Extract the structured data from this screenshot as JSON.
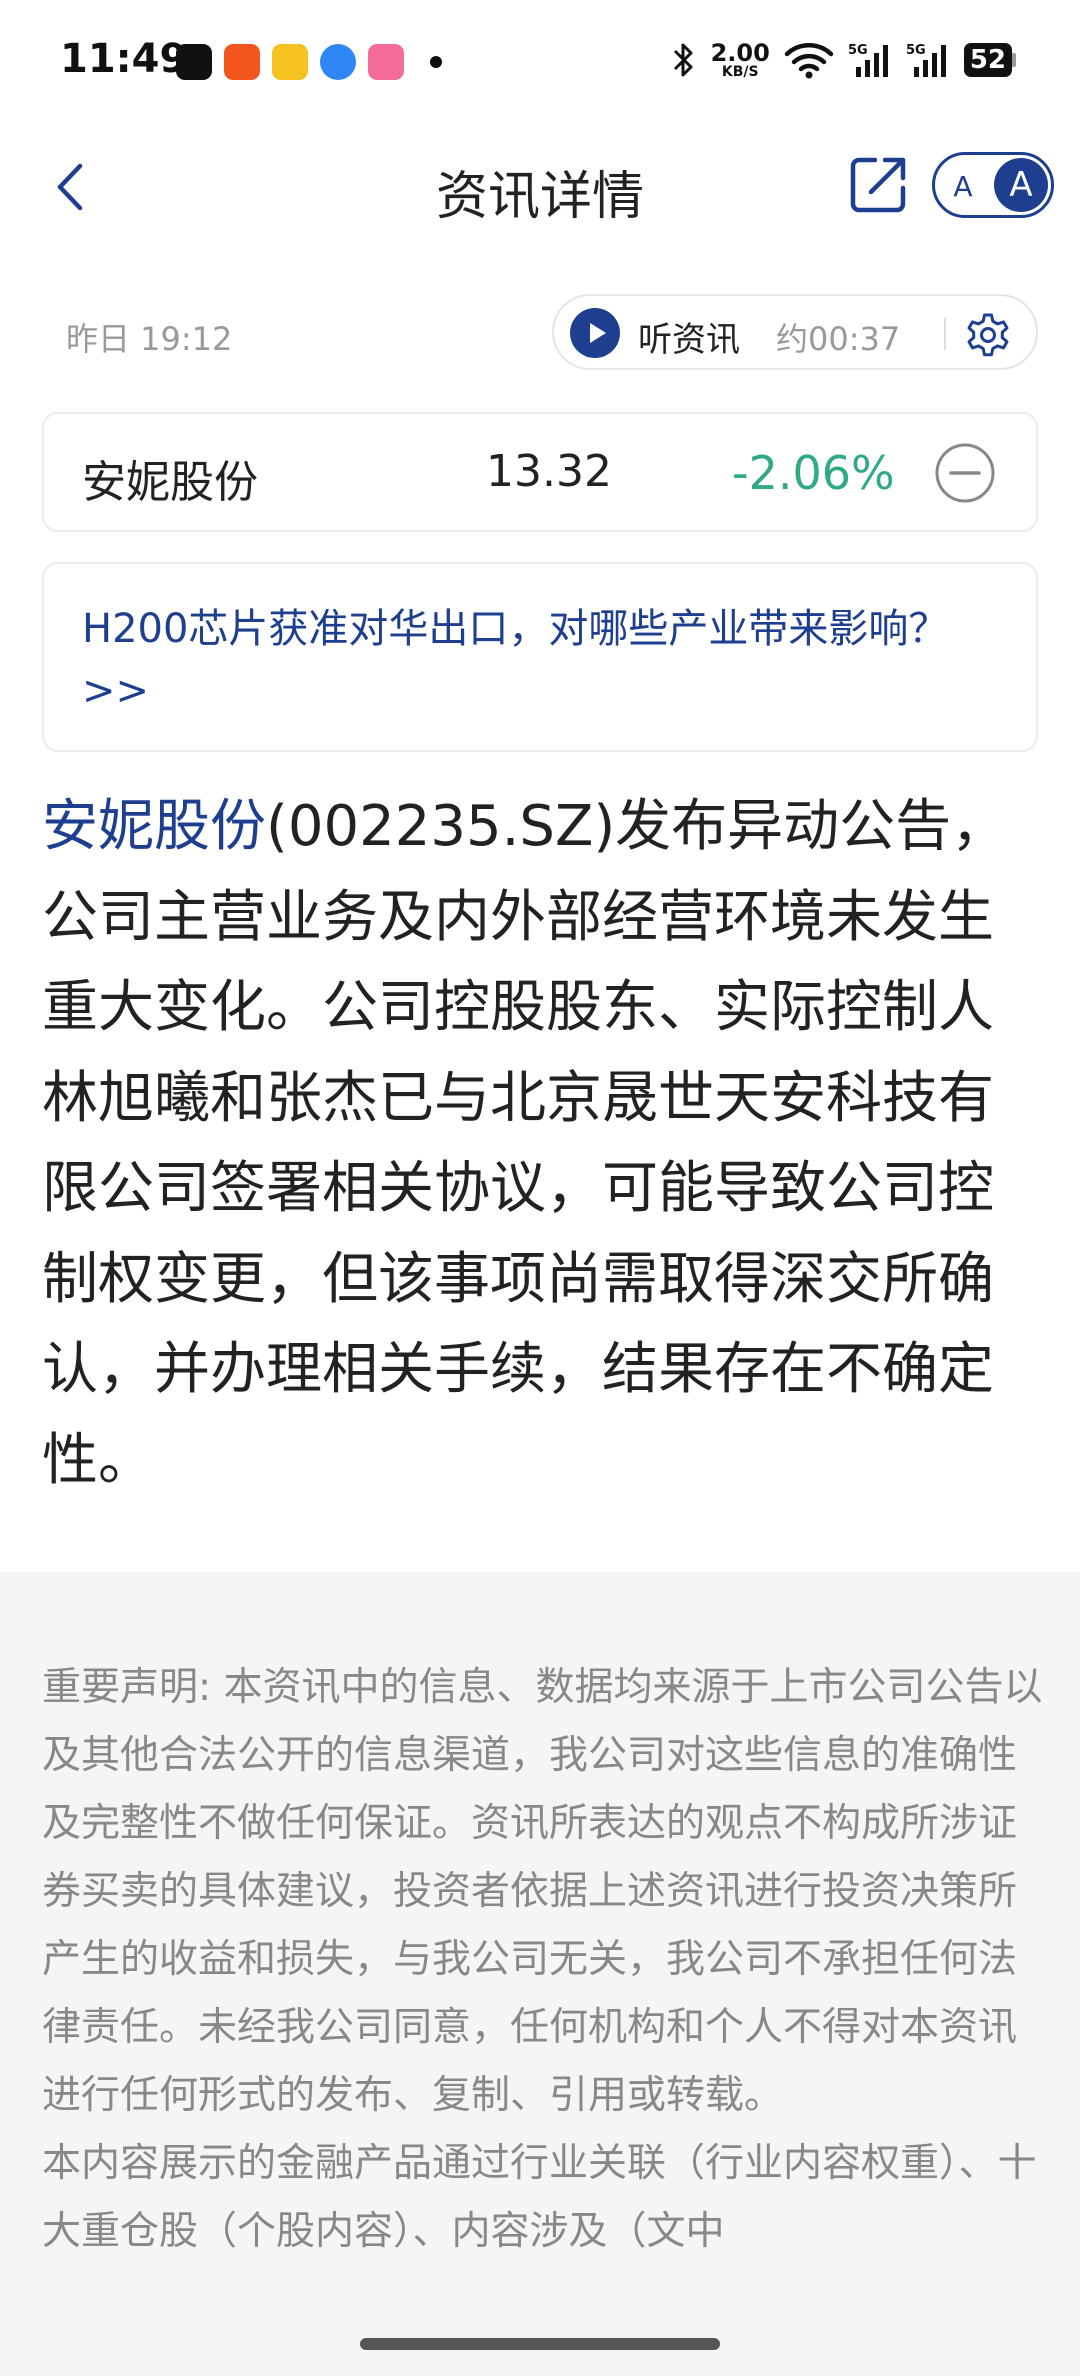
{
  "status_bar": {
    "time": "11:49",
    "net_speed_value": "2.00",
    "net_speed_unit": "KB/S",
    "battery": "52",
    "app_icons": [
      "tiktok-icon",
      "taobao-icon",
      "weibo-icon",
      "ali-icon",
      "bilibili-icon"
    ]
  },
  "nav": {
    "title": "资讯详情",
    "font_toggle_small": "A",
    "font_toggle_large": "A"
  },
  "meta": {
    "time": "昨日 19:12",
    "listen_label": "听资讯",
    "listen_duration": "约00:37"
  },
  "stock": {
    "name": "安妮股份",
    "price": "13.32",
    "change": "-2.06%"
  },
  "topic": {
    "text": "H200芯片获准对华出口，对哪些产业带来影响？>>"
  },
  "article": {
    "stock_link": "安妮股份",
    "body": "(002235.SZ)发布异动公告，公司主营业务及内外部经营环境未发生重大变化。公司控股股东、实际控制人林旭曦和张杰已与北京晟世天安科技有限公司签署相关协议，可能导致公司控制权变更，但该事项尚需取得深交所确认，并办理相关手续，结果存在不确定性。"
  },
  "disclaimer": {
    "statement": "重要声明: 本资讯中的信息、数据均来源于上市公司公告以及其他合法公开的信息渠道，我公司对这些信息的准确性及完整性不做任何保证。资讯所表达的观点不构成所涉证券买卖的具体建议，投资者依据上述资讯进行投资决策所产生的收益和损失，与我公司无关，我公司不承担任何法律责任。未经我公司同意，任何机构和个人不得对本资讯进行任何形式的发布、复制、引用或转载。",
    "product_note": "本内容展示的金融产品通过行业关联（行业内容权重）、十大重仓股（个股内容）、内容涉及（文中"
  },
  "colors": {
    "brand": "#1e3f8f",
    "down": "#2faa84",
    "muted": "#999999",
    "disclaimer_bg": "#f4f5f7"
  }
}
